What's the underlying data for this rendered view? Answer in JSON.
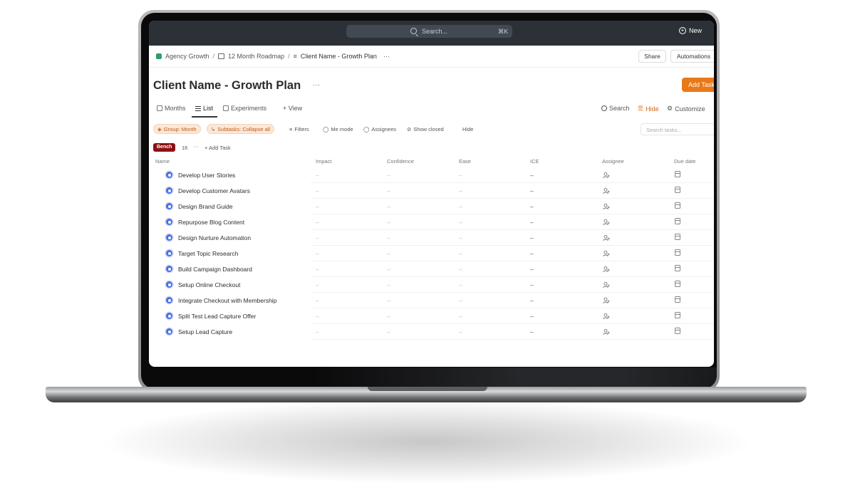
{
  "app": {
    "search_placeholder": "Search...",
    "search_shortcut": "⌘K",
    "new_label": "New"
  },
  "breadcrumb": {
    "workspace": "Agency Growth",
    "folder": "12 Month Roadmap",
    "list": "Client Name - Growth Plan",
    "more": "···"
  },
  "header": {
    "share_label": "Share",
    "automations_label": "Automations",
    "title": "Client Name - Growth Plan",
    "title_more": "···",
    "add_task_label": "Add Task"
  },
  "tabs": {
    "months": "Months",
    "list": "List",
    "experiments": "Experiments",
    "add_view": "+ View",
    "search": "Search",
    "hide": "Hide",
    "customize": "Customize"
  },
  "filters": {
    "group": "Group: Month",
    "subtasks": "Subtasks: Collapse all",
    "filters": "Filters",
    "me_mode": "Me mode",
    "assignees": "Assignees",
    "show_closed": "Show closed",
    "hide": "Hide",
    "search_tasks_placeholder": "Search tasks..."
  },
  "group": {
    "name": "Bench",
    "count": "16",
    "more": "···",
    "add_task": "+ Add Task"
  },
  "columns": {
    "name": "Name",
    "impact": "Impact",
    "confidence": "Confidence",
    "ease": "Ease",
    "ice": "ICE",
    "assignee": "Assignee",
    "due_date": "Due date"
  },
  "empty_value": "–",
  "ice_value": "–",
  "tasks": [
    "Develop User Stories",
    "Develop Customer Avatars",
    "Design Brand Guide",
    "Repurpose Blog Content",
    "Design Nurture Automation",
    "Target Topic Research",
    "Build Campaign Dashboard",
    "Setup Online Checkout",
    "Integrate Checkout with Membership",
    "Split Test Lead Capture Offer",
    "Setup Lead Capture"
  ],
  "colors": {
    "accent": "#e97817",
    "topbar": "#2c3138",
    "status_blue": "#4a6fe0",
    "bench_red": "#8b1111"
  }
}
